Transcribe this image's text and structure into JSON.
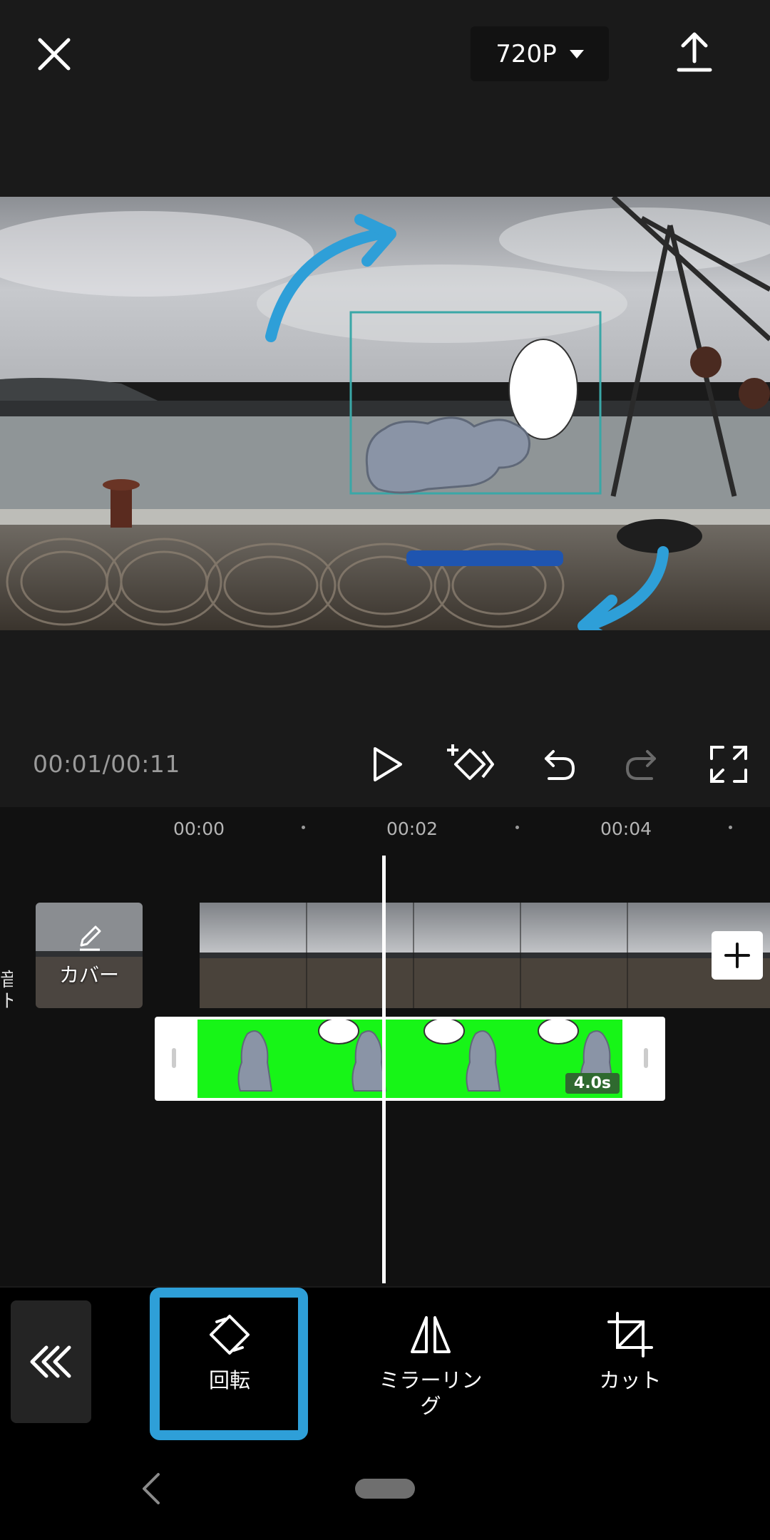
{
  "header": {
    "close_icon": "close-icon",
    "resolution": "720P",
    "export_icon": "upload-icon"
  },
  "player": {
    "timecode": "00:01/00:11",
    "controls": [
      "play-icon",
      "add-keyframe-icon",
      "undo-icon",
      "redo-icon",
      "fullscreen-icon"
    ]
  },
  "timeline": {
    "ruler": [
      "00:00",
      "00:02",
      "00:04"
    ],
    "side_label": "音\nト",
    "cover_label": "カバー",
    "overlay_duration": "4.0s"
  },
  "toolbar": {
    "tools": [
      {
        "label": "回転",
        "icon": "rotate-icon"
      },
      {
        "label": "ミラーリング",
        "icon": "mirror-icon"
      },
      {
        "label": "カット",
        "icon": "crop-icon"
      }
    ]
  },
  "colors": {
    "annotation_blue": "#2e9fd8",
    "overlay_green": "#17f517",
    "background": "#1a1a1a"
  }
}
